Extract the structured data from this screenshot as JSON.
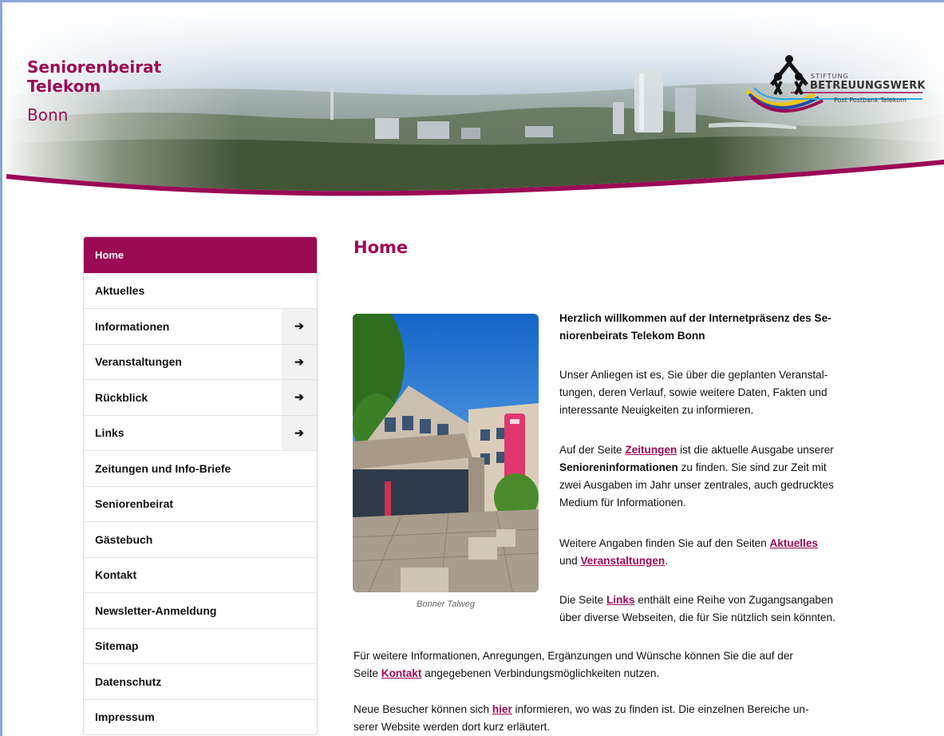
{
  "header": {
    "brand_line1": "Seniorenbeirat",
    "brand_line2": "Telekom",
    "brand_line3": "Bonn",
    "logo": {
      "stiftung": "STIFTUNG",
      "name": "BETREUUNGSWERK",
      "sub": "Post Postbank Telekom"
    }
  },
  "nav": {
    "items": [
      {
        "label": "Home",
        "active": true,
        "has_arrow": false
      },
      {
        "label": "Aktuelles",
        "active": false,
        "has_arrow": false
      },
      {
        "label": "Informationen",
        "active": false,
        "has_arrow": true
      },
      {
        "label": "Veranstaltungen",
        "active": false,
        "has_arrow": true
      },
      {
        "label": "Rückblick",
        "active": false,
        "has_arrow": true
      },
      {
        "label": "Links",
        "active": false,
        "has_arrow": true
      },
      {
        "label": "Zeitungen und Info-Briefe",
        "active": false,
        "has_arrow": false
      },
      {
        "label": "Seniorenbeirat",
        "active": false,
        "has_arrow": false
      },
      {
        "label": "Gästebuch",
        "active": false,
        "has_arrow": false
      },
      {
        "label": "Kontakt",
        "active": false,
        "has_arrow": false
      },
      {
        "label": "Newsletter-Anmeldung",
        "active": false,
        "has_arrow": false
      },
      {
        "label": "Sitemap",
        "active": false,
        "has_arrow": false
      },
      {
        "label": "Datenschutz",
        "active": false,
        "has_arrow": false
      },
      {
        "label": "Impressum",
        "active": false,
        "has_arrow": false
      }
    ],
    "arrow_glyph": "➔"
  },
  "main": {
    "title": "Home",
    "image_caption": "Bonner Talweg",
    "welcome_line1": "Herzlich willkommen auf der Internetpräsenz des Se-",
    "welcome_line2": "niorenbeirats Telekom Bonn",
    "p1_l1": "Unser Anliegen ist es, Sie über die geplanten Veranstal-",
    "p1_l2": "tungen, deren Verlauf, sowie weitere Daten, Fakten und",
    "p1_l3": "interessante Neuigkeiten zu informieren.",
    "p2_pre": "Auf der Seite ",
    "p2_link": "Zeitungen",
    "p2_post": " ist die aktuelle Ausgabe unserer",
    "p2_bold": "Senioreninformationen",
    "p2_l2_rest": " zu finden. Sie sind zur Zeit mit",
    "p2_l3": "zwei Ausgaben im Jahr unser zentrales, auch gedrucktes",
    "p2_l4": "Medium für Informationen.",
    "p3_pre": "Weitere Angaben finden Sie auf den Seiten ",
    "p3_link1": "Aktuelles",
    "p3_mid": "und ",
    "p3_link2": "Veranstaltungen",
    "p3_end": ".",
    "p4_pre": "Die Seite ",
    "p4_link": "Links",
    "p4_post": " enthält eine Reihe von Zugangsangaben",
    "p4_l2": "über diverse Webseiten, die für Sie nützlich sein könnten.",
    "p5_l1": "Für weitere Informationen, Anregungen, Ergänzungen  und  Wünsche können Sie die auf der",
    "p5_pre": "Seite ",
    "p5_link": "Kontakt",
    "p5_post": " angegebenen Verbindungsmöglichkeiten nutzen.",
    "p6_pre": "Neue Besucher können sich ",
    "p6_link": "hier",
    "p6_post": " informieren, wo was zu finden ist. Die einzelnen Bereiche un-",
    "p6_l2": "serer Website werden dort kurz erläutert."
  },
  "colors": {
    "accent": "#9b0a55",
    "frame": "#8aa6d6"
  }
}
